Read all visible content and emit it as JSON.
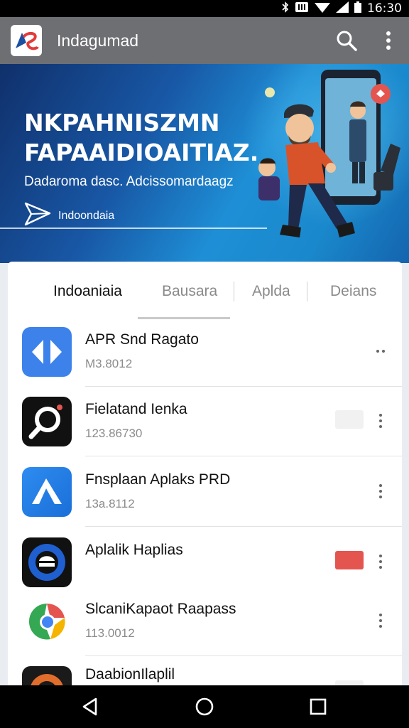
{
  "status_bar": {
    "time": "16:30",
    "icons": [
      "bluetooth-icon",
      "nfc-icon",
      "wifi-icon",
      "signal-icon",
      "battery-icon"
    ]
  },
  "app_bar": {
    "title": "Indagumad",
    "icons": [
      "search-icon",
      "more-vert-icon"
    ]
  },
  "hero": {
    "headline_line1": "NKPAHNISZMN",
    "headline_line2": "FAPAAIDIOAITIAZ.",
    "subtitle": "Dadaroma dasc. Adcissomardaagz",
    "brand_label": "Indoondaia"
  },
  "tabs": [
    {
      "label": "Indoaniaia",
      "active": true
    },
    {
      "label": "Bausara",
      "active": false
    },
    {
      "label": "Aplda",
      "active": false
    },
    {
      "label": "Deians",
      "active": false
    }
  ],
  "apps": [
    {
      "name": "APR Snd Ragato",
      "meta": "M3.8012"
    },
    {
      "name": "Fielatand Ienka",
      "meta": "123.86730"
    },
    {
      "name": "Fnsplaan Aplaks PRD",
      "meta": "13a.8112"
    },
    {
      "name": "Aplalik Haplias",
      "meta": ""
    },
    {
      "name": "SlcaniKapaot Raapass",
      "meta": "113.0012"
    },
    {
      "name": "DaabionIlaplil",
      "meta": ""
    }
  ],
  "colors": {
    "accent_red": "#e4554f",
    "hero_blue": "#1e8fd6",
    "app_bar": "#6e6f73"
  }
}
